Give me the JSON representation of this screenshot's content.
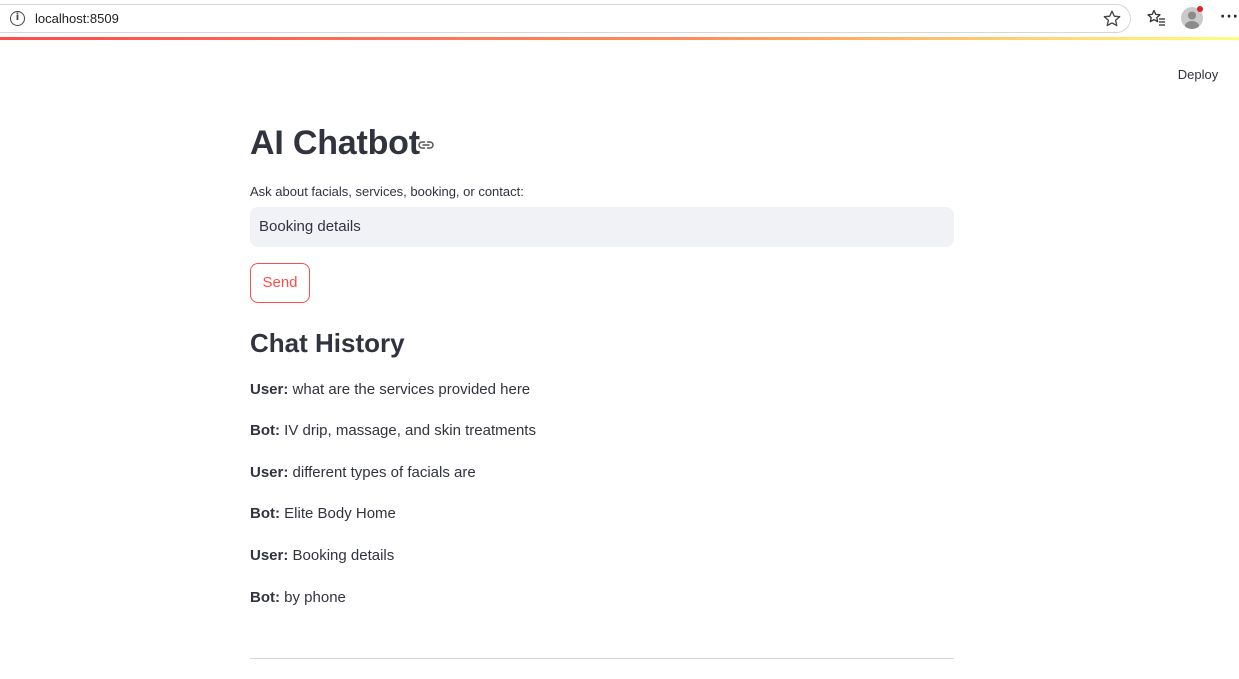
{
  "browser": {
    "url": "localhost:8509"
  },
  "header": {
    "deploy_label": "Deploy"
  },
  "main": {
    "title": "AI Chatbot",
    "input_label": "Ask about facials, services, booking, or contact:",
    "input_value": "Booking details",
    "send_label": "Send",
    "history_heading": "Chat History",
    "messages": [
      {
        "role": "User:",
        "text": " what are the services provided here"
      },
      {
        "role": "Bot:",
        "text": " IV drip, massage, and skin treatments"
      },
      {
        "role": "User:",
        "text": " different types of facials are"
      },
      {
        "role": "Bot:",
        "text": " Elite Body Home"
      },
      {
        "role": "User:",
        "text": " Booking details"
      },
      {
        "role": "Bot:",
        "text": " by phone"
      }
    ]
  },
  "colors": {
    "accent": "#ff4b4b",
    "text": "#31333f",
    "input_bg": "#f0f2f6"
  },
  "icons": {
    "site_info": "info-icon",
    "bookmark": "star-icon",
    "favorites": "favorites-icon",
    "profile": "profile-icon",
    "menu": "more-icon",
    "anchor": "link-icon"
  }
}
